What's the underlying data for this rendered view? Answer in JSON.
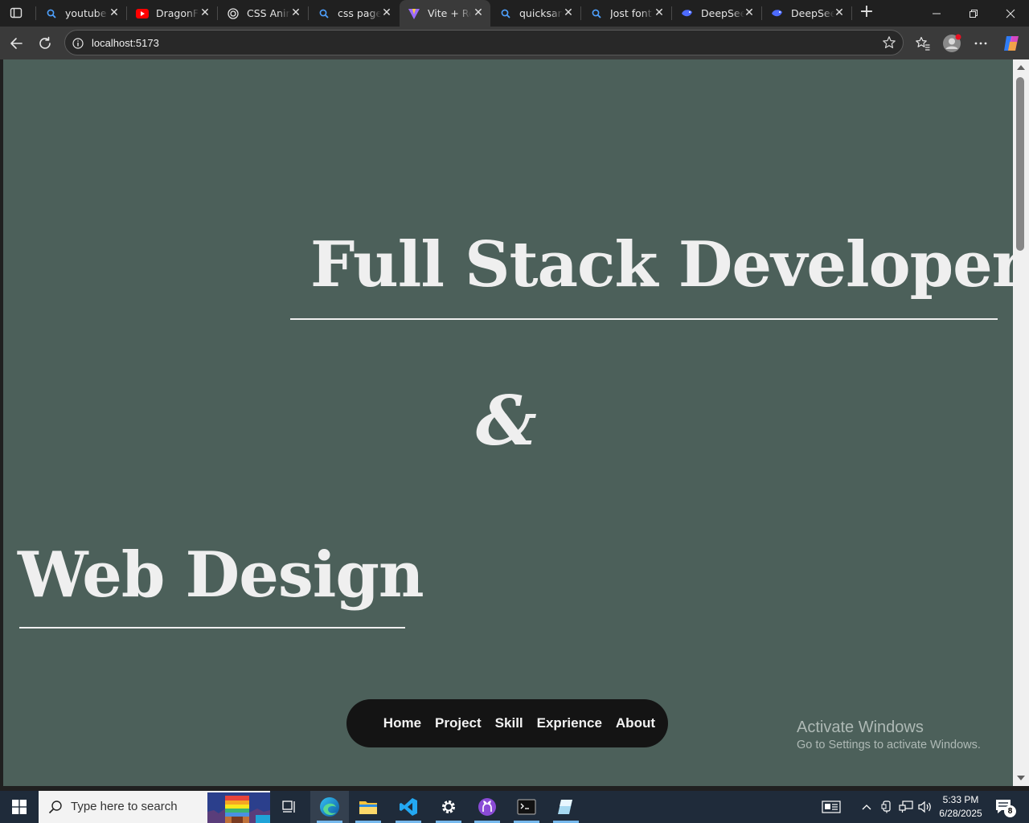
{
  "browser": {
    "tabs": [
      {
        "title": "youtube -",
        "icon": "search-icon"
      },
      {
        "title": "DragonFo",
        "icon": "youtube-icon"
      },
      {
        "title": "CSS Anim",
        "icon": "openai-icon"
      },
      {
        "title": "css page t",
        "icon": "search-icon"
      },
      {
        "title": "Vite + Re",
        "icon": "vite-icon",
        "active": true
      },
      {
        "title": "quicksand",
        "icon": "search-icon"
      },
      {
        "title": "Jost font -",
        "icon": "search-icon"
      },
      {
        "title": "DeepSeek",
        "icon": "deepseek-icon"
      },
      {
        "title": "DeepSeek",
        "icon": "deepseek-icon"
      }
    ],
    "address": "localhost:5173"
  },
  "page": {
    "headline_1": "Full Stack Developer",
    "ampersand": "&",
    "headline_2": "Web Design",
    "nav": [
      "Home",
      "Project",
      "Skill",
      "Exprience",
      "About"
    ],
    "background": "#4c605a",
    "nav_background": "#141414",
    "text_color": "#efefef"
  },
  "watermark": {
    "title": "Activate Windows",
    "subtitle": "Go to Settings to activate Windows."
  },
  "taskbar": {
    "search_placeholder": "Type here to search",
    "time": "5:33 PM",
    "date": "6/28/2025",
    "notifications": "8"
  }
}
